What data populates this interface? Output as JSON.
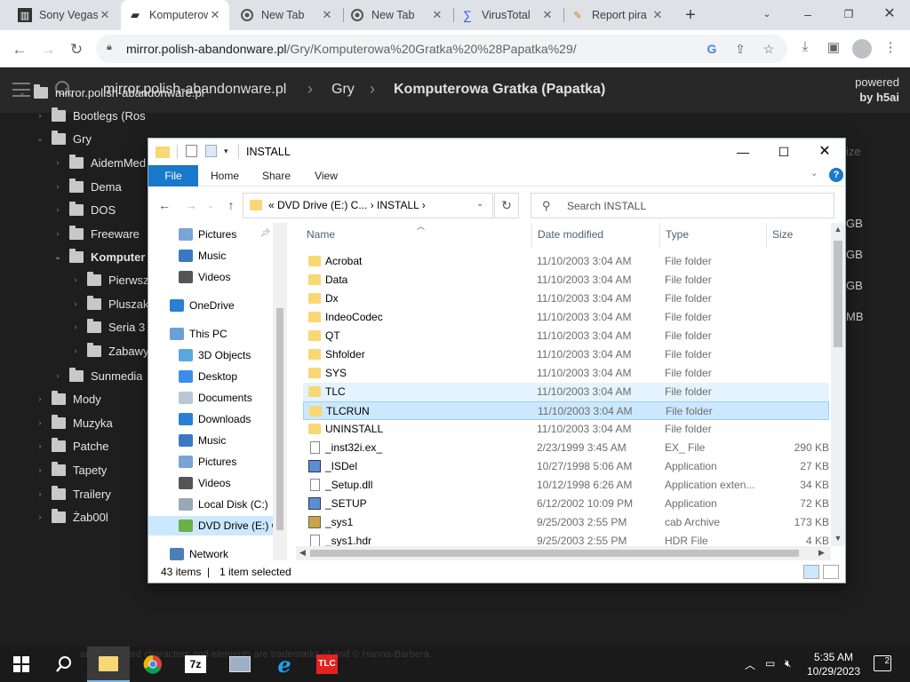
{
  "browser": {
    "tabs": [
      {
        "title": "Sony Vegas",
        "icon": "film-icon"
      },
      {
        "title": "Komputerowa",
        "icon": "folder-icon",
        "active": true
      },
      {
        "title": "New Tab",
        "icon": "chrome-icon"
      },
      {
        "title": "New Tab",
        "icon": "chrome-icon"
      },
      {
        "title": "VirusTotal",
        "icon": "virustotal-icon"
      },
      {
        "title": "Report pira",
        "icon": "pen-icon"
      }
    ],
    "url_host": "mirror.polish-abandonware.pl",
    "url_path": "/Gry/Komputerowa%20Gratka%20%28Papatka%29/"
  },
  "h5ai": {
    "breadcrumb": [
      "mirror.polish-abandonware.pl",
      "Gry",
      "Komputerowa Gratka (Papatka)"
    ],
    "powered_line1": "powered",
    "powered_line2": "by h5ai",
    "tree": [
      {
        "label": "mirror.polish-abandonware.pl",
        "level": 0,
        "expanded": true
      },
      {
        "label": "Bootlegs (Ros",
        "level": 1
      },
      {
        "label": "Gry",
        "level": 1,
        "expanded": true
      },
      {
        "label": "AidemMed",
        "level": 2
      },
      {
        "label": "Dema",
        "level": 2
      },
      {
        "label": "DOS",
        "level": 2
      },
      {
        "label": "Freeware",
        "level": 2
      },
      {
        "label": "Komputer",
        "level": 2,
        "expanded": true,
        "bold": true
      },
      {
        "label": "Pierwsz",
        "level": 3
      },
      {
        "label": "Pluszak",
        "level": 3
      },
      {
        "label": "Seria 3",
        "level": 3
      },
      {
        "label": "Zabawy",
        "level": 3
      },
      {
        "label": "Sunmedia",
        "level": 2
      },
      {
        "label": "Mody",
        "level": 1
      },
      {
        "label": "Muzyka",
        "level": 1
      },
      {
        "label": "Patche",
        "level": 1
      },
      {
        "label": "Tapety",
        "level": 1
      },
      {
        "label": "Trailery",
        "level": 1
      },
      {
        "label": "Żab00l",
        "level": 1
      }
    ],
    "size_header": "ize",
    "sizes": [
      "GB",
      "GB",
      "GB",
      "MB"
    ]
  },
  "explorer": {
    "title": "INSTALL",
    "ribbon_tabs": [
      "File",
      "Home",
      "Share",
      "View"
    ],
    "address_path": "DVD Drive (E:) C...",
    "address_last": "INSTALL",
    "search_placeholder": "Search INSTALL",
    "nav_items": [
      {
        "label": "Pictures",
        "indent": 1,
        "icon": "pictures-icon"
      },
      {
        "label": "Music",
        "indent": 1,
        "icon": "music-icon"
      },
      {
        "label": "Videos",
        "indent": 1,
        "icon": "videos-icon"
      },
      {
        "label": "OneDrive",
        "indent": 0,
        "icon": "onedrive-icon"
      },
      {
        "label": "This PC",
        "indent": 0,
        "icon": "pc-icon"
      },
      {
        "label": "3D Objects",
        "indent": 1,
        "icon": "cube-icon"
      },
      {
        "label": "Desktop",
        "indent": 1,
        "icon": "desktop-icon"
      },
      {
        "label": "Documents",
        "indent": 1,
        "icon": "documents-icon"
      },
      {
        "label": "Downloads",
        "indent": 1,
        "icon": "downloads-icon"
      },
      {
        "label": "Music",
        "indent": 1,
        "icon": "music-icon"
      },
      {
        "label": "Pictures",
        "indent": 1,
        "icon": "pictures-icon"
      },
      {
        "label": "Videos",
        "indent": 1,
        "icon": "videos-icon"
      },
      {
        "label": "Local Disk (C:)",
        "indent": 1,
        "icon": "disk-icon"
      },
      {
        "label": "DVD Drive (E:) C",
        "indent": 1,
        "icon": "dvd-icon",
        "selected": true
      },
      {
        "label": "Network",
        "indent": 0,
        "icon": "network-icon"
      }
    ],
    "columns": [
      "Name",
      "Date modified",
      "Type",
      "Size"
    ],
    "files": [
      {
        "name": "Acrobat",
        "date": "11/10/2003 3:04 AM",
        "type": "File folder",
        "size": "",
        "kind": "folder"
      },
      {
        "name": "Data",
        "date": "11/10/2003 3:04 AM",
        "type": "File folder",
        "size": "",
        "kind": "folder"
      },
      {
        "name": "Dx",
        "date": "11/10/2003 3:04 AM",
        "type": "File folder",
        "size": "",
        "kind": "folder"
      },
      {
        "name": "IndeoCodec",
        "date": "11/10/2003 3:04 AM",
        "type": "File folder",
        "size": "",
        "kind": "folder"
      },
      {
        "name": "QT",
        "date": "11/10/2003 3:04 AM",
        "type": "File folder",
        "size": "",
        "kind": "folder"
      },
      {
        "name": "Shfolder",
        "date": "11/10/2003 3:04 AM",
        "type": "File folder",
        "size": "",
        "kind": "folder"
      },
      {
        "name": "SYS",
        "date": "11/10/2003 3:04 AM",
        "type": "File folder",
        "size": "",
        "kind": "folder"
      },
      {
        "name": "TLC",
        "date": "11/10/2003 3:04 AM",
        "type": "File folder",
        "size": "",
        "kind": "folder",
        "state": "hover"
      },
      {
        "name": "TLCRUN",
        "date": "11/10/2003 3:04 AM",
        "type": "File folder",
        "size": "",
        "kind": "folder",
        "state": "selected"
      },
      {
        "name": "UNINSTALL",
        "date": "11/10/2003 3:04 AM",
        "type": "File folder",
        "size": "",
        "kind": "folder"
      },
      {
        "name": "_inst32i.ex_",
        "date": "2/23/1999 3:45 AM",
        "type": "EX_ File",
        "size": "290 KB",
        "kind": "file"
      },
      {
        "name": "_ISDel",
        "date": "10/27/1998 5:06 AM",
        "type": "Application",
        "size": "27 KB",
        "kind": "app"
      },
      {
        "name": "_Setup.dll",
        "date": "10/12/1998 6:26 AM",
        "type": "Application exten...",
        "size": "34 KB",
        "kind": "file"
      },
      {
        "name": "_SETUP",
        "date": "6/12/2002 10:09 PM",
        "type": "Application",
        "size": "72 KB",
        "kind": "app"
      },
      {
        "name": "_sys1",
        "date": "9/25/2003 2:55 PM",
        "type": "cab Archive",
        "size": "173 KB",
        "kind": "cab"
      },
      {
        "name": "_sys1.hdr",
        "date": "9/25/2003 2:55 PM",
        "type": "HDR File",
        "size": "4 KB",
        "kind": "file"
      }
    ],
    "status_count": "43 items",
    "status_selected": "1 item selected"
  },
  "taskbar": {
    "caption": "and all related characters and elements are trademarks of and © Hanna-Barbera.",
    "time": "5:35 AM",
    "date": "10/29/2023",
    "notifications": "2"
  }
}
